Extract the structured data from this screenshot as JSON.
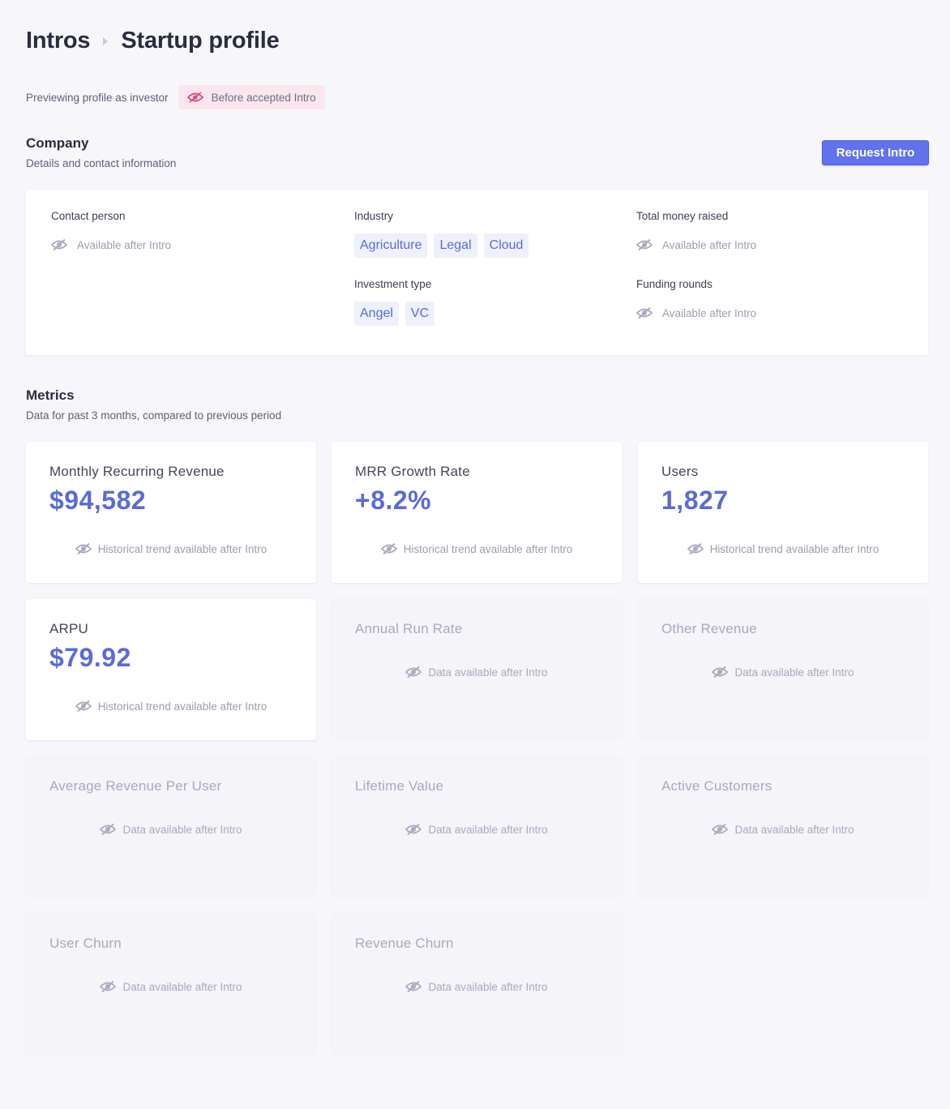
{
  "header": {
    "crumb": "Intros",
    "title": "Startup profile"
  },
  "preview": {
    "text": "Previewing profile as investor",
    "badge": "Before accepted Intro"
  },
  "company": {
    "title": "Company",
    "subtitle": "Details and contact information",
    "request_button": "Request Intro",
    "contact_label": "Contact person",
    "contact_value": "Available after Intro",
    "industry_label": "Industry",
    "industry_tags": [
      "Agriculture",
      "Legal",
      "Cloud"
    ],
    "investment_label": "Investment type",
    "investment_tags": [
      "Angel",
      "VC"
    ],
    "money_label": "Total money raised",
    "money_value": "Available after Intro",
    "rounds_label": "Funding rounds",
    "rounds_value": "Available after Intro"
  },
  "metrics": {
    "title": "Metrics",
    "subtitle": "Data for past 3 months, compared to previous period",
    "cards": [
      {
        "title": "Monthly Recurring Revenue",
        "value": "$94,582",
        "note": "Historical trend available after Intro"
      },
      {
        "title": "MRR Growth Rate",
        "value": "+8.2%",
        "note": "Historical trend available after Intro"
      },
      {
        "title": "Users",
        "value": "1,827",
        "note": "Historical trend available after Intro"
      },
      {
        "title": "ARPU",
        "value": "$79.92",
        "note": "Historical trend available after Intro"
      },
      {
        "title": "Annual Run Rate",
        "note": "Data available after Intro"
      },
      {
        "title": "Other Revenue",
        "note": "Data available after Intro"
      },
      {
        "title": "Average Revenue Per User",
        "note": "Data available after Intro"
      },
      {
        "title": "Lifetime Value",
        "note": "Data available after Intro"
      },
      {
        "title": "Active Customers",
        "note": "Data available after Intro"
      },
      {
        "title": "User Churn",
        "note": "Data available after Intro"
      },
      {
        "title": "Revenue Churn",
        "note": "Data available after Intro"
      }
    ]
  },
  "colors": {
    "accent": "#5a6bd8",
    "button": "#6272ee",
    "badge_bg": "#fbe6ee",
    "badge_icon": "#e0487e"
  },
  "icons": {
    "hidden": "eye-off-icon"
  }
}
